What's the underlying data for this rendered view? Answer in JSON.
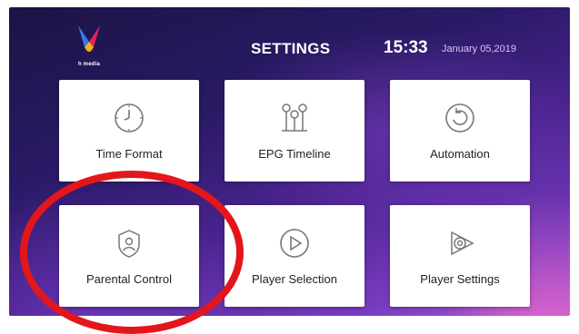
{
  "header": {
    "logo_text": "h media",
    "title": "SETTINGS",
    "time": "15:33",
    "date": "January 05,2019"
  },
  "tiles": [
    {
      "label": "Time Format",
      "icon": "clock-icon"
    },
    {
      "label": "EPG Timeline",
      "icon": "timeline-icon"
    },
    {
      "label": "Automation",
      "icon": "refresh-icon"
    },
    {
      "label": "Parental Control",
      "icon": "shield-user-icon"
    },
    {
      "label": "Player Selection",
      "icon": "play-circle-icon"
    },
    {
      "label": "Player Settings",
      "icon": "player-settings-icon"
    }
  ],
  "colors": {
    "background_top": "#2a1a66",
    "background_bottom": "#b45ad0",
    "tile_background": "#ffffff",
    "annotation_circle": "#e3161b"
  }
}
